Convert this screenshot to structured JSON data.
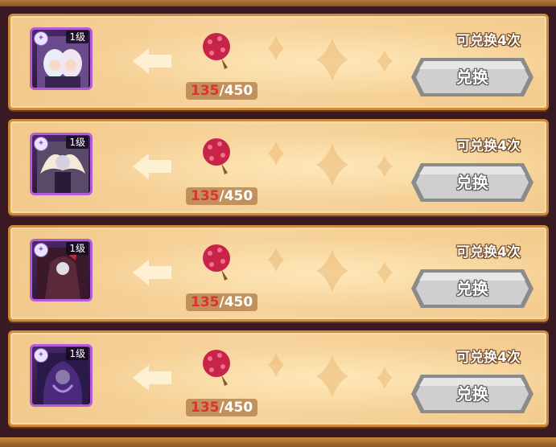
{
  "colors": {
    "frame": "#d08a3c",
    "panel": "#f6d49e",
    "count_current": "#d8352e",
    "button": "#c9c9c9"
  },
  "rows": [
    {
      "level": "1级",
      "current": "135",
      "total": "/450",
      "limit": "可兑换4次",
      "button": "兑换",
      "hero_icon": "hero-portrait-twins"
    },
    {
      "level": "1级",
      "current": "135",
      "total": "/450",
      "limit": "可兑换4次",
      "button": "兑换",
      "hero_icon": "hero-portrait-winged"
    },
    {
      "level": "1级",
      "current": "135",
      "total": "/450",
      "limit": "可兑换4次",
      "button": "兑换",
      "hero_icon": "hero-portrait-dark-wizard"
    },
    {
      "level": "1级",
      "current": "135",
      "total": "/450",
      "limit": "可兑换4次",
      "button": "兑换",
      "hero_icon": "hero-portrait-shadow"
    }
  ]
}
